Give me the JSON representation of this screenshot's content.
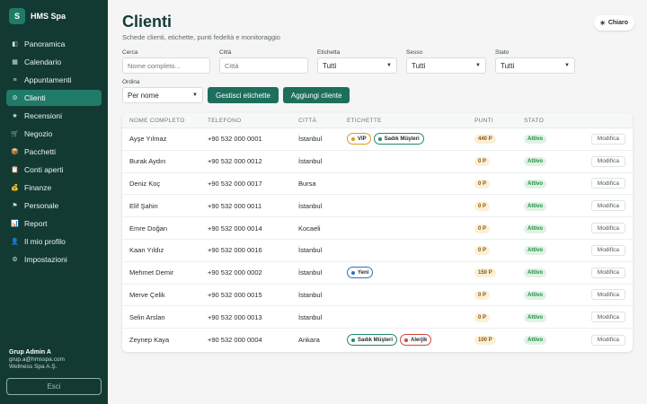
{
  "sidebar": {
    "brand_logo": "S",
    "brand_name": "HMS Spa",
    "items": [
      {
        "label": "Panoramica",
        "icon": "panel-icon",
        "glyph": "◧"
      },
      {
        "label": "Calendario",
        "icon": "calendar-icon",
        "glyph": "▦"
      },
      {
        "label": "Appuntamenti",
        "icon": "list-icon",
        "glyph": "≡"
      },
      {
        "label": "Clienti",
        "icon": "gear-icon",
        "glyph": "⚙",
        "active": true
      },
      {
        "label": "Recensioni",
        "icon": "star-icon",
        "glyph": "★"
      },
      {
        "label": "Negozio",
        "icon": "cart-icon",
        "glyph": "🛒"
      },
      {
        "label": "Pacchetti",
        "icon": "package-icon",
        "glyph": "📦"
      },
      {
        "label": "Conti aperti",
        "icon": "clipboard-icon",
        "glyph": "📋"
      },
      {
        "label": "Finanze",
        "icon": "money-bag-icon",
        "glyph": "💰"
      },
      {
        "label": "Personale",
        "icon": "flag-icon",
        "glyph": "⚑"
      },
      {
        "label": "Report",
        "icon": "chart-icon",
        "glyph": "📊"
      },
      {
        "label": "Il mio profilo",
        "icon": "user-icon",
        "glyph": "👤"
      },
      {
        "label": "Impostazioni",
        "icon": "settings-icon",
        "glyph": "⚙"
      }
    ],
    "user_name": "Grup Admin A",
    "user_email": "grup.a@hmsspa.com",
    "user_company": "Wellness Spa A.Ş.",
    "logout_label": "Esci"
  },
  "header": {
    "title": "Clienti",
    "subtitle": "Schede clienti, etichette, punti fedeltà e monitoraggio",
    "theme_label": "Chiaro",
    "theme_icon": "sun-icon"
  },
  "filters": {
    "search_label": "Cerca",
    "search_placeholder": "Nome completo...",
    "city_label": "Città",
    "city_placeholder": "Città",
    "tag_label": "Etichetta",
    "tag_value": "Tutti",
    "gender_label": "Sesso",
    "gender_value": "Tutti",
    "status_label": "Stato",
    "status_value": "Tutti",
    "sort_label": "Ordina",
    "sort_value": "Per nome",
    "manage_tags_label": "Gestisci etichette",
    "add_client_label": "Aggiungi cliente"
  },
  "table": {
    "columns": [
      "NOME COMPLETO",
      "TELEFONO",
      "CITTÀ",
      "ETICHETTE",
      "PUNTI",
      "STATO"
    ],
    "edit_label": "Modifica",
    "rows": [
      {
        "name": "Ayşe Yılmaz",
        "phone": "+90 532 000 0001",
        "city": "İstanbul",
        "tags": [
          {
            "label": "VIP",
            "color": "#d99a1e"
          },
          {
            "label": "Sadık Müşteri",
            "color": "#1f8a6a"
          }
        ],
        "points": "440 P",
        "status": "Attivo"
      },
      {
        "name": "Burak Aydın",
        "phone": "+90 532 000 0012",
        "city": "İstanbul",
        "tags": [],
        "points": "0 P",
        "status": "Attivo"
      },
      {
        "name": "Deniz Koç",
        "phone": "+90 532 000 0017",
        "city": "Bursa",
        "tags": [],
        "points": "0 P",
        "status": "Attivo"
      },
      {
        "name": "Elif Şahin",
        "phone": "+90 532 000 0011",
        "city": "İstanbul",
        "tags": [],
        "points": "0 P",
        "status": "Attivo"
      },
      {
        "name": "Emre Doğan",
        "phone": "+90 532 000 0014",
        "city": "Kocaeli",
        "tags": [],
        "points": "0 P",
        "status": "Attivo"
      },
      {
        "name": "Kaan Yıldız",
        "phone": "+90 532 000 0016",
        "city": "İstanbul",
        "tags": [],
        "points": "0 P",
        "status": "Attivo"
      },
      {
        "name": "Mehmet Demir",
        "phone": "+90 532 000 0002",
        "city": "İstanbul",
        "tags": [
          {
            "label": "Yeni",
            "color": "#2f6fc4"
          }
        ],
        "points": "150 P",
        "status": "Attivo"
      },
      {
        "name": "Merve Çelik",
        "phone": "+90 532 000 0015",
        "city": "İstanbul",
        "tags": [],
        "points": "0 P",
        "status": "Attivo"
      },
      {
        "name": "Selin Arslan",
        "phone": "+90 532 000 0013",
        "city": "İstanbul",
        "tags": [],
        "points": "0 P",
        "status": "Attivo"
      },
      {
        "name": "Zeynep Kaya",
        "phone": "+90 532 000 0004",
        "city": "Ankara",
        "tags": [
          {
            "label": "Sadık Müşteri",
            "color": "#1f8a6a"
          },
          {
            "label": "Alerjik",
            "color": "#d0453d"
          }
        ],
        "points": "100 P",
        "status": "Attivo"
      }
    ]
  }
}
